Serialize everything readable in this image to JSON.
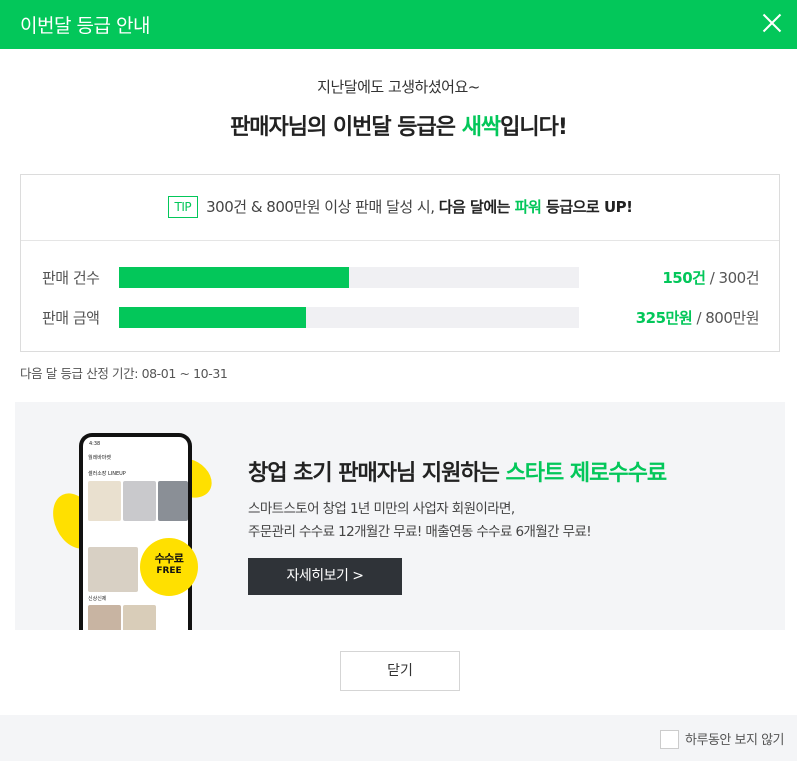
{
  "header": {
    "title": "이번달 등급 안내"
  },
  "intro": {
    "subtitle": "지난달에도 고생하셨어요~",
    "headline_prefix": "판매자님의 이번달 등급은 ",
    "grade": "새싹",
    "headline_suffix": "입니다!"
  },
  "tip": {
    "badge": "TIP",
    "text_normal": "300건 & 800만원 이상 판매 달성 시, ",
    "text_bold": "다음 달에는 ",
    "target_grade": "파워",
    "text_end": " 등급으로 UP!"
  },
  "progress": [
    {
      "label": "판매 건수",
      "current": "150건",
      "target": " / 300건",
      "ratio": 0.5
    },
    {
      "label": "판매 금액",
      "current": "325만원",
      "target": " / 800만원",
      "ratio": 0.406
    }
  ],
  "period": "다음 달 등급 산정 기간: 08-01 ~ 10-31",
  "banner": {
    "title_prefix": "창업 초기 판매자님 지원하는 ",
    "title_highlight": "스타트 제로수수료",
    "desc_line1": "스마트스토어 창업 1년 미만의 사업자 회원이라면,",
    "desc_line2": "주문관리 수수료 12개월간 무료! 매출연동 수수료 6개월간 무료!",
    "button": "자세히보기 >",
    "badge_line1": "수수료",
    "badge_line2": "FREE",
    "phone": {
      "status_time": "4:38",
      "store_name": "월레바마켓",
      "section1": "셀러소장 LINEUP",
      "section2": "신상신제"
    }
  },
  "close_button": "닫기",
  "footer": {
    "no_show_label": "하루동안 보지 않기"
  },
  "colors": {
    "brand": "#03c75a",
    "badge_yellow": "#ffe000",
    "button_dark": "#2f3338"
  }
}
